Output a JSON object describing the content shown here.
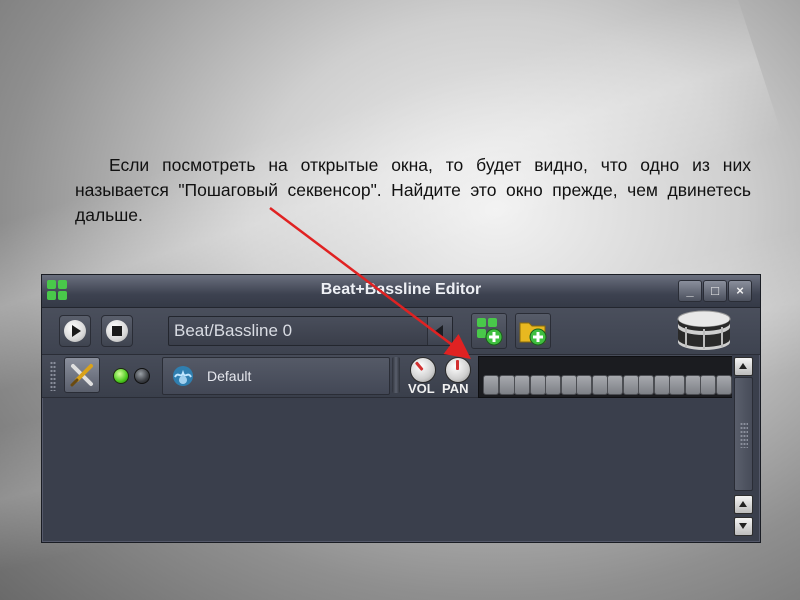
{
  "caption": {
    "text": "Если посмотреть на открытые окна, то будет видно, что одно из них называется \"Пошаговый секвенсор\". Найдите это окно прежде, чем двинетесь дальше."
  },
  "window": {
    "title": "Beat+Bassline Editor",
    "app_icon": "beat-grid-icon",
    "minimize_icon": "minimize-icon",
    "maximize_icon": "maximize-icon",
    "close_icon": "close-icon",
    "minimize_glyph": "_",
    "maximize_glyph": "□",
    "close_glyph": "×"
  },
  "toolbar": {
    "play_icon": "play-icon",
    "stop_icon": "stop-icon",
    "selected_beat": "Beat/Bassline 0",
    "add_beat_icon": "add-beat-icon",
    "add_track_icon": "add-track-icon",
    "drum_icon": "drum-icon"
  },
  "track": {
    "instrument_name": "Default",
    "tools_icon": "wrench-screwdriver-icon",
    "vol_label": "VOL",
    "pan_label": "PAN",
    "step_count": 16
  },
  "colors": {
    "window_bg": "#3a3f4c",
    "accent_green": "#49c84a",
    "annotation_arrow": "#e02222"
  }
}
